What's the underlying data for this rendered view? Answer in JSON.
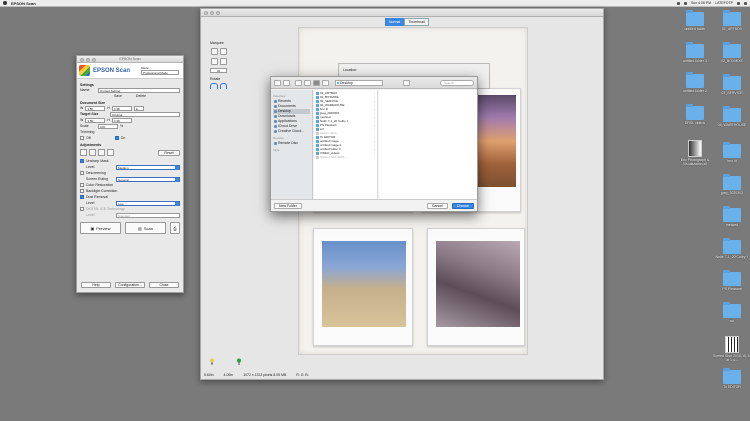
{
  "menubar": {
    "app_name": "EPSON Scan",
    "clock": "Sun 4:06 PM",
    "user": "LATEFOTP"
  },
  "preview": {
    "tabs": [
      "Normal",
      "Thumbnail"
    ],
    "marquee_label": "Marquee",
    "zoom_value": "30",
    "rotate_label": "Rotate",
    "status": [
      "5.60in",
      "4.00in",
      "1072 x 1313 pixels 8.05 MB",
      "R: G: B:"
    ]
  },
  "epson": {
    "window_title": "EPSON Scan",
    "brand": "EPSON Scan",
    "mode_label": "Mode:",
    "mode_value": "Professional Mode",
    "settings_label": "Settings",
    "name_label": "Name:",
    "name_value": "Current Setting",
    "save_label": "Save",
    "delete_label": "Delete",
    "doc_size_label": "Document Size",
    "doc_w": "3.55",
    "doc_h": "4.38",
    "target_size_label": "Target Size",
    "target_value": "Original",
    "target_w": "3.55",
    "target_h": "4.38",
    "scale_label": "Scale",
    "scale_value": "100",
    "trimming_label": "Trimming",
    "off_label": "Off",
    "on_label": "On",
    "adjustments_label": "Adjustments",
    "reset_label": "Reset",
    "unsharp_label": "Unsharp Mask",
    "level_label": "Level",
    "unsharp_level": "Medium",
    "descreening_label": "Descreening",
    "screen_ruling_label": "Screen Ruling",
    "screen_ruling_value": "General",
    "color_restoration_label": "Color Restoration",
    "backlight_label": "Backlight Correction",
    "dust_label": "Dust Removal",
    "dust_level": "Low",
    "digital_ice_label": "DIGITAL ICE Technology",
    "ice_level": "Standard",
    "preview_label": "Preview",
    "scan_label": "Scan",
    "help_label": "Help",
    "config_label": "Configuration...",
    "close_label": "Close"
  },
  "dialog": {
    "location": "Desktop",
    "search_placeholder": "Search",
    "favorites_label": "Favorites",
    "sidebar": [
      "Recents",
      "Documents",
      "Desktop",
      "Downloads",
      "Applications",
      "iCloud Drive",
      "Creative Cloud..."
    ],
    "selected_sidebar": "Desktop",
    "devices_label": "Devices",
    "devices": [
      "Remote Disc"
    ],
    "tags_label": "Tags",
    "files": [
      {
        "name": "01_ARTBOX",
        "dim": false
      },
      {
        "name": "02_BOXMIXE",
        "dim": false
      },
      {
        "name": "03_SERVICE",
        "dim": false
      },
      {
        "name": "04_WAREHOUSE",
        "dim": false
      },
      {
        "name": "bno lit",
        "dim": false
      },
      {
        "name": "jpeg_2020303",
        "dim": false
      },
      {
        "name": "mecked",
        "dim": false
      },
      {
        "name": "Neiltr 7-1_20 Colby 1",
        "dim": false
      },
      {
        "name": "PS Pleasant",
        "dim": false
      },
      {
        "name": "scl",
        "dim": false
      },
      {
        "name": "Screen Shot...",
        "dim": true
      },
      {
        "name": "To EDITOR",
        "dim": false
      },
      {
        "name": "untitled image",
        "dim": false
      },
      {
        "name": "untitled image 2",
        "dim": false
      },
      {
        "name": "untitled folder 4",
        "dim": false
      },
      {
        "name": "VIDEO_videos",
        "dim": false
      },
      {
        "name": "Screen Shot 2018-...",
        "dim": true
      }
    ],
    "new_folder_label": "New Folder",
    "cancel_label": "Cancel",
    "choose_label": "Choose"
  },
  "desktop_icons": [
    {
      "label": "untitled folder",
      "type": "folder"
    },
    {
      "label": "01_ARTBOX",
      "type": "folder"
    },
    {
      "label": "untitled folder 3",
      "type": "folder"
    },
    {
      "label": "02_BOXMIXE",
      "type": "folder"
    },
    {
      "label": "untitled folder 2",
      "type": "folder"
    },
    {
      "label": "03_SERVICE",
      "type": "folder"
    },
    {
      "label": "DRSL videos",
      "type": "folder"
    },
    {
      "label": "04_WAREHOUSE",
      "type": "folder"
    },
    {
      "label": "Eric Photograph & Visualization.xlf",
      "type": "dark"
    },
    {
      "label": "bno lit",
      "type": "folder"
    },
    {
      "label": "jpeg_2020303",
      "type": "folder"
    },
    {
      "label": "mecked",
      "type": "folder"
    },
    {
      "label": "Neiltr 7-1_20 Colby 1",
      "type": "folder"
    },
    {
      "label": "PS Pleasant",
      "type": "folder"
    },
    {
      "label": "scl",
      "type": "folder"
    },
    {
      "label": "Screen Shot 2018-10-14 at 1.4...",
      "type": "bars"
    },
    {
      "label": "To EDITOR",
      "type": "folder"
    }
  ]
}
